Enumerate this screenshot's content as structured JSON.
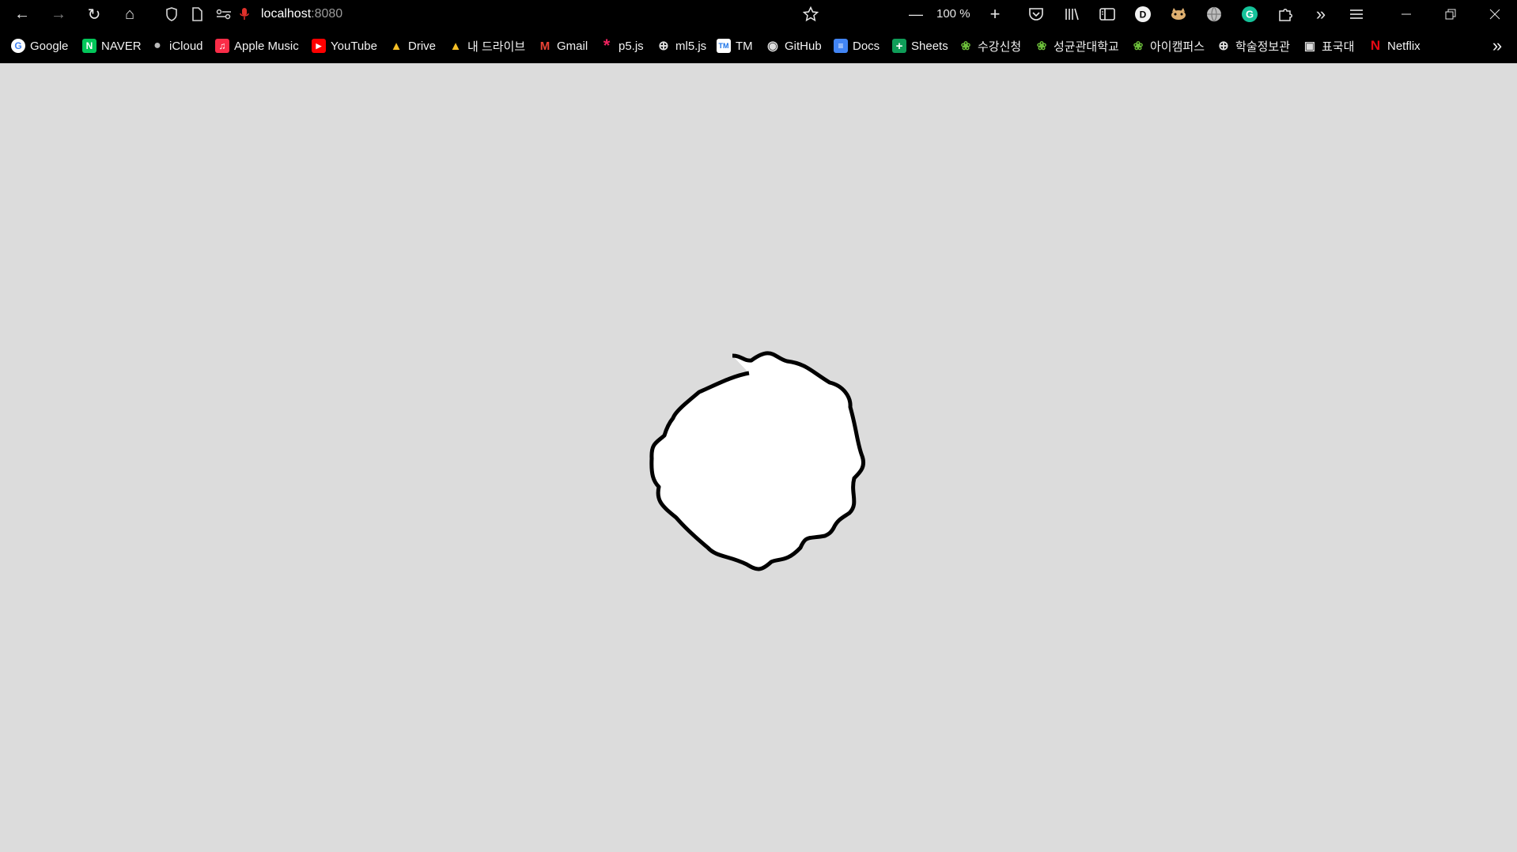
{
  "toolbar": {
    "back_icon": "arrow-left-icon",
    "forward_icon": "arrow-right-icon",
    "reload_icon": "reload-icon",
    "home_icon": "home-icon",
    "url_host": "localhost",
    "url_port": ":8080",
    "zoom_level": "100 %"
  },
  "bookmarks": [
    {
      "label": "Google",
      "icon": "google-icon",
      "color": "#4285F4",
      "glyph": "G"
    },
    {
      "label": "NAVER",
      "icon": "naver-icon",
      "color": "#03C75A",
      "glyph": "N"
    },
    {
      "label": "iCloud",
      "icon": "apple-icon",
      "color": "#000000",
      "glyph": ""
    },
    {
      "label": "Apple Music",
      "icon": "music-icon",
      "color": "#FA2D48",
      "glyph": "♫"
    },
    {
      "label": "YouTube",
      "icon": "youtube-icon",
      "color": "#FF0000",
      "glyph": "▶"
    },
    {
      "label": "Drive",
      "icon": "drive-icon",
      "color": "#1FA463",
      "glyph": "▲"
    },
    {
      "label": "내 드라이브",
      "icon": "drive-icon",
      "color": "#1FA463",
      "glyph": "▲"
    },
    {
      "label": "Gmail",
      "icon": "gmail-icon",
      "color": "#EA4335",
      "glyph": "M"
    },
    {
      "label": "p5.js",
      "icon": "p5js-icon",
      "color": "#ED225D",
      "glyph": "*"
    },
    {
      "label": "ml5.js",
      "icon": "globe-icon",
      "color": "#000000",
      "glyph": "⊕"
    },
    {
      "label": "TM",
      "icon": "tm-icon",
      "color": "#1A73E8",
      "glyph": "TM"
    },
    {
      "label": "GitHub",
      "icon": "github-icon",
      "color": "#000000",
      "glyph": "◉"
    },
    {
      "label": "Docs",
      "icon": "docs-icon",
      "color": "#4285F4",
      "glyph": "≡"
    },
    {
      "label": "Sheets",
      "icon": "sheets-icon",
      "color": "#0F9D58",
      "glyph": "+"
    },
    {
      "label": "수강신청",
      "icon": "skku-icon",
      "color": "#2E7D32",
      "glyph": "❀"
    },
    {
      "label": "성균관대학교",
      "icon": "skku-icon",
      "color": "#2E7D32",
      "glyph": "❀"
    },
    {
      "label": "아이캠퍼스",
      "icon": "skku-icon",
      "color": "#2E7D32",
      "glyph": "❀"
    },
    {
      "label": "학술정보관",
      "icon": "globe-icon",
      "color": "#000000",
      "glyph": "⊕"
    },
    {
      "label": "표국대",
      "icon": "dict-icon",
      "color": "#000000",
      "glyph": "▣"
    },
    {
      "label": "Netflix",
      "icon": "netflix-icon",
      "color": "#E50914",
      "glyph": "N"
    }
  ],
  "canvas": {
    "background": "#dcdcdc",
    "shape_fill": "#ffffff",
    "shape_stroke": "#000000"
  }
}
